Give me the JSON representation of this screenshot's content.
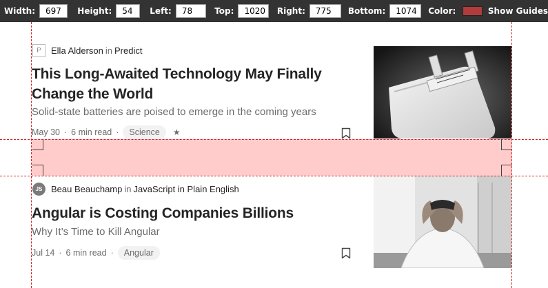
{
  "toolbar": {
    "fields": [
      {
        "label": "Width:",
        "value": "697"
      },
      {
        "label": "Height:",
        "value": "54"
      },
      {
        "label": "Left:",
        "value": "78"
      },
      {
        "label": "Top:",
        "value": "1020"
      },
      {
        "label": "Right:",
        "value": "775"
      },
      {
        "label": "Bottom:",
        "value": "1074"
      }
    ],
    "color_label": "Color:",
    "color_value": "#b23b3b",
    "show_guides_label": "Show Guides"
  },
  "articles": [
    {
      "avatar_glyph": "P",
      "author": "Ella Alderson",
      "in_word": "in",
      "publication": "Predict",
      "title": "This Long-Awaited Technology May Finally Change the World",
      "subtitle": "Solid-state batteries are poised to emerge in the coming years",
      "date": "May 30",
      "read_time": "6 min read",
      "tag": "Science",
      "star": "★",
      "bookmark_icon": "bookmark-outline"
    },
    {
      "avatar_glyph": "JS",
      "author": "Beau Beauchamp",
      "in_word": "in",
      "publication": "JavaScript in Plain English",
      "title": "Angular is Costing Companies Billions",
      "subtitle": "Why It’s Time to Kill Angular",
      "date": "Jul 14",
      "read_time": "6 min read",
      "tag": "Angular",
      "bookmark_icon": "bookmark-outline"
    }
  ],
  "colors": {
    "toolbar_bg": "#333333",
    "guide": "#cc2222",
    "highlight": "#ff8282",
    "text_primary": "#242424",
    "text_muted": "#6b6b6b"
  }
}
